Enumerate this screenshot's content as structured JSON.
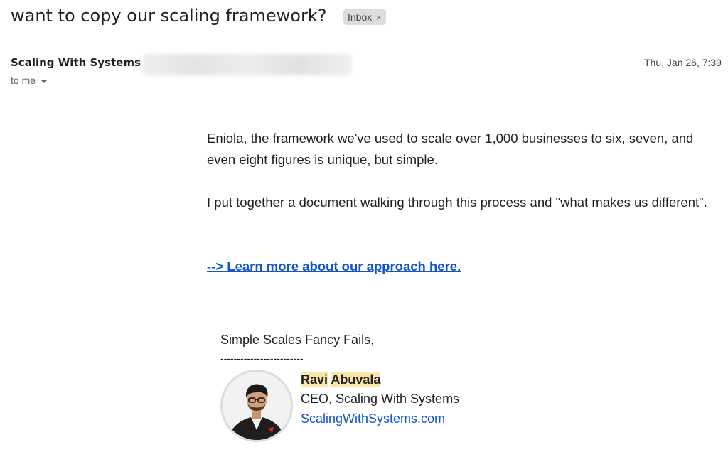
{
  "email": {
    "subject": "want to copy our scaling framework?",
    "label_chip": {
      "label": "Inbox",
      "remove_glyph": "×"
    },
    "sender_name": "Scaling With Systems",
    "date": "Thu, Jan 26, 7:39",
    "recipient": "to me",
    "body": {
      "paragraph_1": "Eniola, the framework we've used to scale over 1,000 businesses to six, seven, and even eight figures is unique, but simple.",
      "paragraph_2": "I put together a document walking through this process and \"what makes us different\".",
      "cta_link": "--> Learn more about our approach here."
    },
    "signature": {
      "closing": "Simple Scales Fancy Fails,",
      "divider": "-------------------------",
      "name_first": "Ravi",
      "name_last": "Abuvala",
      "title": "CEO, Scaling With Systems",
      "website": "ScalingWithSystems.com"
    }
  },
  "colors": {
    "link": "#1155cc",
    "name_highlight": "#fce5a6",
    "chip_background": "#dddddd"
  },
  "icons": {
    "recipient_details": "caret-down-icon",
    "chip_remove": "close-icon"
  }
}
